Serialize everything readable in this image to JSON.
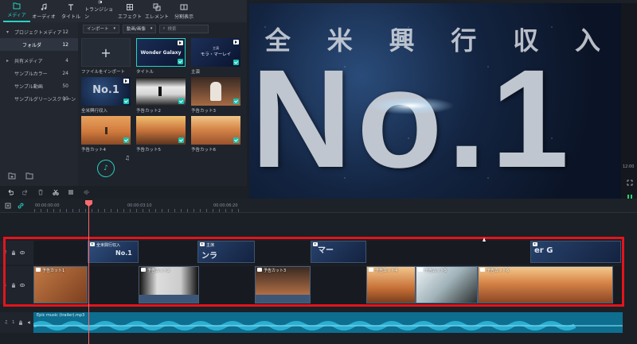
{
  "toolbar": {
    "items": [
      {
        "label": "メディア",
        "icon": "folder-icon",
        "active": true
      },
      {
        "label": "オーディオ",
        "icon": "music-note-icon"
      },
      {
        "label": "タイトル",
        "icon": "text-icon"
      },
      {
        "label": "トランジション",
        "icon": "transition-icon"
      },
      {
        "label": "エフェクト",
        "icon": "effects-icon"
      },
      {
        "label": "エレメント",
        "icon": "elements-icon"
      },
      {
        "label": "分割表示",
        "icon": "split-screen-icon"
      }
    ]
  },
  "sidebar": {
    "items": [
      {
        "label": "プロジェクトメディア",
        "count": "12"
      },
      {
        "label": "フォルダ",
        "count": "12"
      },
      {
        "label": "共有メディア",
        "count": "4"
      },
      {
        "label": "サンプルカラー",
        "count": "24"
      },
      {
        "label": "サンプル動画",
        "count": "50"
      },
      {
        "label": "サンプルグリーンスクリーン",
        "count": "10"
      }
    ]
  },
  "media": {
    "import_label": "インポート",
    "filter_label": "動画/画像",
    "search_placeholder": "検索",
    "import_tile_label": "ファイルをインポート",
    "items": [
      {
        "caption": "タイトル",
        "thumb_text": "Wonder Galaxy"
      },
      {
        "caption": "主演",
        "thumb_text_top": "主演",
        "thumb_text": "モラ・マーレイ"
      },
      {
        "caption": "全米興行収入",
        "thumb_text": "No.1"
      },
      {
        "caption": "予告カット2"
      },
      {
        "caption": "予告カット3"
      },
      {
        "caption": "予告カット4"
      },
      {
        "caption": "予告カット5"
      },
      {
        "caption": "予告カット6"
      }
    ]
  },
  "preview": {
    "headline": [
      "全",
      "米",
      "興",
      "行",
      "収",
      "入"
    ],
    "big_text": "No.1",
    "side_time": "12:00"
  },
  "timeline": {
    "ruler_labels": [
      "00:00:00:00",
      "00:00:03:10",
      "00:00:06:20"
    ],
    "track_labels": [
      "2",
      "1",
      "1"
    ],
    "title_clips": [
      {
        "label": "全米興行収入",
        "text": "No.1"
      },
      {
        "label": "主演",
        "text": "ンラ"
      },
      {
        "label": "",
        "text": "マー"
      },
      {
        "label": "",
        "text": "er G"
      }
    ],
    "video_clips": [
      {
        "label": "予告カット1"
      },
      {
        "label": "予告カット2"
      },
      {
        "label": "予告カット3"
      },
      {
        "label": "予告カット4"
      },
      {
        "label": "予告カット5"
      },
      {
        "label": "予告カット6"
      }
    ],
    "audio_label": "Epic music (trailer).mp3"
  },
  "colors": {
    "accent": "#27d3c0",
    "highlight": "#e3141c",
    "playhead": "#ff6b6b",
    "audio": "#0d6e8f"
  }
}
